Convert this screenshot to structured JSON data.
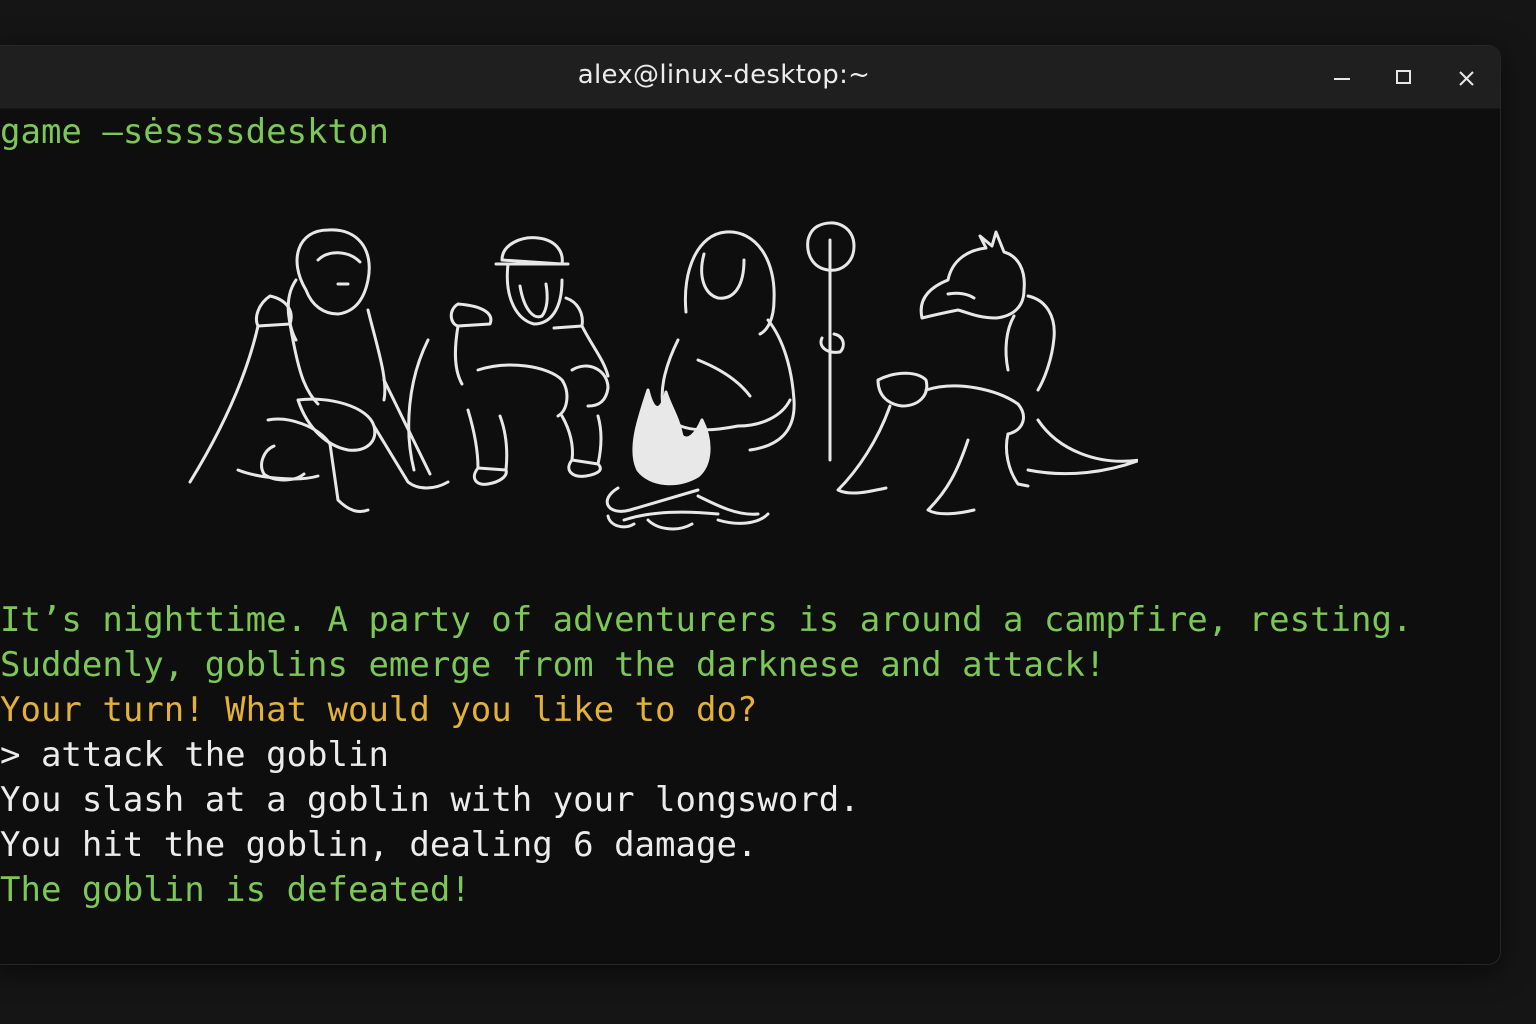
{
  "window": {
    "title": "alex@linux-desktop:~",
    "controls": {
      "minimize_icon": "minimize-icon",
      "maximize_icon": "maximize-icon",
      "close_icon": "close-icon"
    }
  },
  "terminal": {
    "session_line": "game —sėssssdeskton",
    "art": "campfire-party-illustration",
    "lines": [
      {
        "text": "It’s nighttime. A party of adventurers is around a campfire, resting.",
        "color": "green"
      },
      {
        "text": "Suddenly, goblins emerge from the darknese and attack!",
        "color": "green"
      },
      {
        "text": "Your turn! What would you like to do?",
        "color": "yellow"
      },
      {
        "text": "> attack the goblin",
        "color": "white"
      },
      {
        "text": "You slash at a goblin with your longsword.",
        "color": "white"
      },
      {
        "text": "You hit the goblin, dealing 6 damage.",
        "color": "white"
      },
      {
        "text": "The goblin is defeated!",
        "color": "green"
      }
    ]
  },
  "colors": {
    "background": "#151515",
    "terminal_bg": "#0e0e0e",
    "titlebar_bg": "#1f1f1f",
    "green": "#7cc756",
    "yellow": "#e3b13a",
    "white": "#ececec"
  }
}
